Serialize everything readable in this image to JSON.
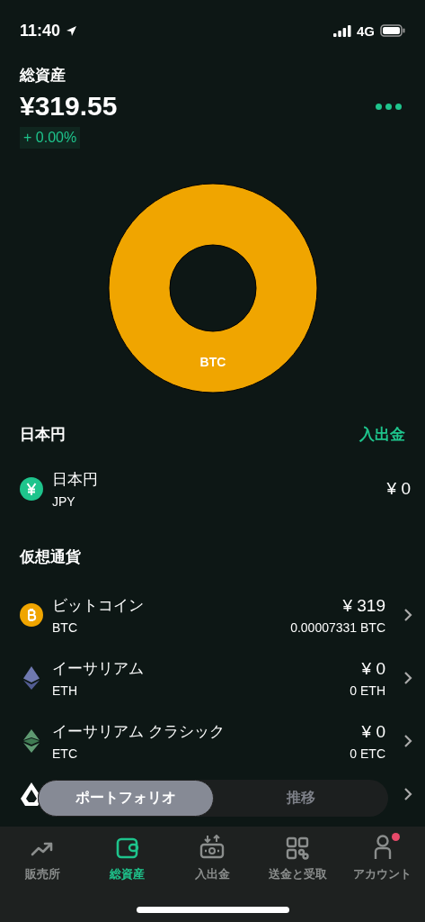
{
  "status_bar": {
    "time": "11:40",
    "network": "4G"
  },
  "header": {
    "title": "総資産",
    "total": "¥319.55",
    "change": "+ 0.00%"
  },
  "allocation": {
    "segments": [
      {
        "label": "BTC",
        "color": "#f0a500"
      }
    ]
  },
  "fiat": {
    "title": "日本円",
    "action": "入出金",
    "rows": [
      {
        "kind": "jpy",
        "name": "日本円",
        "code": "JPY",
        "value": "¥ 0"
      }
    ]
  },
  "crypto": {
    "title": "仮想通貨",
    "rows": [
      {
        "kind": "btc",
        "name": "ビットコイン",
        "code": "BTC",
        "value": "¥ 319",
        "amount": "0.00007331 BTC"
      },
      {
        "kind": "eth",
        "name": "イーサリアム",
        "code": "ETH",
        "value": "¥ 0",
        "amount": "0 ETH"
      },
      {
        "kind": "etc",
        "name": "イーサリアム クラシック",
        "code": "ETC",
        "value": "¥ 0",
        "amount": "0 ETC"
      },
      {
        "kind": "lsk"
      }
    ]
  },
  "view_toggle": [
    {
      "label": "ポートフォリオ",
      "selected": true
    },
    {
      "label": "推移",
      "selected": false
    }
  ],
  "tab_bar": [
    {
      "kind": "trend",
      "label": "販売所",
      "selected": false,
      "badge": false
    },
    {
      "kind": "wallet",
      "label": "総資産",
      "selected": true,
      "badge": false
    },
    {
      "kind": "cash",
      "label": "入出金",
      "selected": false,
      "badge": false
    },
    {
      "kind": "qr",
      "label": "送金と受取",
      "selected": false,
      "badge": false
    },
    {
      "kind": "person",
      "label": "アカウント",
      "selected": false,
      "badge": true
    }
  ]
}
